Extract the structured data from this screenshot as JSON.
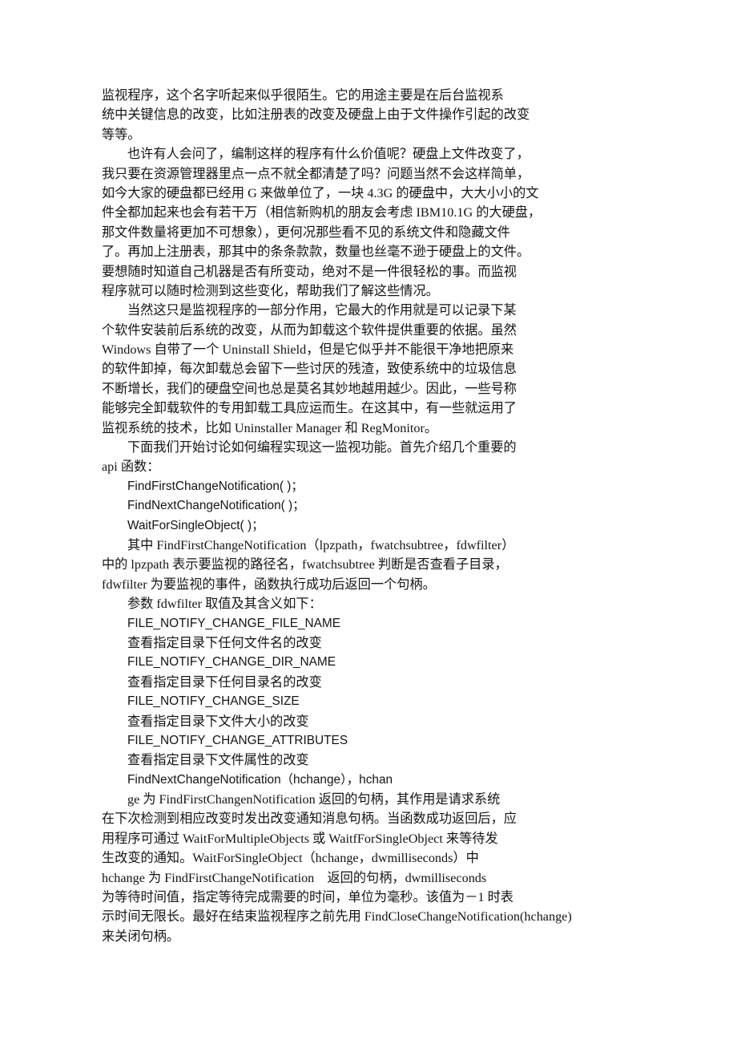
{
  "document": {
    "page_background": "#ffffff",
    "text_color": "#141414",
    "lines": [
      {
        "id": "l1",
        "indent": 0,
        "script": "cjk",
        "text": "监视程序，这个名字听起来似乎很陌生。它的用途主要是在后台监视系"
      },
      {
        "id": "l2",
        "indent": 0,
        "script": "cjk",
        "text": "统中关键信息的改变，比如注册表的改变及硬盘上由于文件操作引起的改变"
      },
      {
        "id": "l3",
        "indent": 0,
        "script": "cjk",
        "text": "等等。"
      },
      {
        "id": "l4",
        "indent": 1,
        "script": "cjk",
        "text": "也许有人会问了，编制这样的程序有什么价值呢？硬盘上文件改变了，"
      },
      {
        "id": "l5",
        "indent": 0,
        "script": "cjk",
        "text": "我只要在资源管理器里点一点不就全都清楚了吗？问题当然不会这样简单，"
      },
      {
        "id": "l6",
        "indent": 0,
        "script": "cjk",
        "text": "如今大家的硬盘都已经用 G 来做单位了，一块 4.3G 的硬盘中，大大小小的文"
      },
      {
        "id": "l7",
        "indent": 0,
        "script": "cjk",
        "text": "件全都加起来也会有若干万（相信新购机的朋友会考虑 IBM10.1G 的大硬盘，"
      },
      {
        "id": "l8",
        "indent": 0,
        "script": "cjk",
        "text": "那文件数量将更加不可想象），更何况那些看不见的系统文件和隐藏文件"
      },
      {
        "id": "l9",
        "indent": 0,
        "script": "cjk",
        "text": "了。再加上注册表，那其中的条条款款，数量也丝毫不逊于硬盘上的文件。"
      },
      {
        "id": "l10",
        "indent": 0,
        "script": "cjk",
        "text": "要想随时知道自己机器是否有所变动，绝对不是一件很轻松的事。而监视"
      },
      {
        "id": "l11",
        "indent": 0,
        "script": "cjk",
        "text": "程序就可以随时检测到这些变化，帮助我们了解这些情况。"
      },
      {
        "id": "l12",
        "indent": 1,
        "script": "cjk",
        "text": "当然这只是监视程序的一部分作用，它最大的作用就是可以记录下某"
      },
      {
        "id": "l13",
        "indent": 0,
        "script": "cjk",
        "text": "个软件安装前后系统的改变，从而为卸载这个软件提供重要的依据。虽然"
      },
      {
        "id": "l14",
        "indent": 0,
        "script": "cjk",
        "text": "Windows 自带了一个 Uninstall Shield，但是它似乎并不能很干净地把原来"
      },
      {
        "id": "l15",
        "indent": 0,
        "script": "cjk",
        "text": "的软件卸掉，每次卸载总会留下一些讨厌的残渣，致使系统中的垃圾信息"
      },
      {
        "id": "l16",
        "indent": 0,
        "script": "cjk",
        "text": "不断增长，我们的硬盘空间也总是莫名其妙地越用越少。因此，一些号称"
      },
      {
        "id": "l17",
        "indent": 0,
        "script": "cjk",
        "text": "能够完全卸载软件的专用卸载工具应运而生。在这其中，有一些就运用了"
      },
      {
        "id": "l18",
        "indent": 0,
        "script": "cjk",
        "text": "监视系统的技术，比如 Uninstaller Manager 和 RegMonitor。"
      },
      {
        "id": "l19",
        "indent": 1,
        "script": "cjk",
        "text": "下面我们开始讨论如何编程实现这一监视功能。首先介绍几个重要的"
      },
      {
        "id": "l20",
        "indent": 0,
        "script": "cjk",
        "text": "api 函数："
      },
      {
        "id": "l21",
        "indent": 1,
        "script": "sans",
        "text": "FindFirstChangeNotification( )；"
      },
      {
        "id": "l22",
        "indent": 1,
        "script": "sans",
        "text": "FindNextChangeNotification( )；"
      },
      {
        "id": "l23",
        "indent": 1,
        "script": "sans",
        "text": "WaitForSingleObject( )；"
      },
      {
        "id": "l24",
        "indent": 1,
        "script": "cjk",
        "text": "其中 FindFirstChangeNotification（lpzpath，fwatchsubtree，fdwfilter）"
      },
      {
        "id": "l25",
        "indent": 0,
        "script": "cjk",
        "text": "中的 lpzpath 表示要监视的路径名，fwatchsubtree 判断是否查看子目录，"
      },
      {
        "id": "l26",
        "indent": 0,
        "script": "cjk",
        "text": "fdwfilter 为要监视的事件，函数执行成功后返回一个句柄。"
      },
      {
        "id": "l27",
        "indent": 1,
        "script": "cjk",
        "text": "参数 fdwfilter 取值及其含义如下："
      },
      {
        "id": "l28",
        "indent": 1,
        "script": "sans",
        "text": "FILE_NOTIFY_CHANGE_FILE_NAME"
      },
      {
        "id": "l29",
        "indent": 1,
        "script": "cjk",
        "text": "查看指定目录下任何文件名的改变"
      },
      {
        "id": "l30",
        "indent": 1,
        "script": "sans",
        "text": "FILE_NOTIFY_CHANGE_DIR_NAME"
      },
      {
        "id": "l31",
        "indent": 1,
        "script": "cjk",
        "text": "查看指定目录下任何目录名的改变"
      },
      {
        "id": "l32",
        "indent": 1,
        "script": "sans",
        "text": "FILE_NOTIFY_CHANGE_SIZE"
      },
      {
        "id": "l33",
        "indent": 1,
        "script": "cjk",
        "text": "查看指定目录下文件大小的改变"
      },
      {
        "id": "l34",
        "indent": 1,
        "script": "sans",
        "text": "FILE_NOTIFY_CHANGE_ATTRIBUTES"
      },
      {
        "id": "l35",
        "indent": 1,
        "script": "cjk",
        "text": "查看指定目录下文件属性的改变"
      },
      {
        "id": "l36",
        "indent": 1,
        "script": "sans",
        "text": "FindNextChangeNotification（hchange），hchan"
      },
      {
        "id": "l37",
        "indent": 1,
        "script": "cjk",
        "text": "ge 为 FindFirstChangenNotification 返回的句柄，其作用是请求系统"
      },
      {
        "id": "l38",
        "indent": 0,
        "script": "cjk",
        "text": "在下次检测到相应改变时发出改变通知消息句柄。当函数成功返回后，应"
      },
      {
        "id": "l39",
        "indent": 0,
        "script": "cjk",
        "text": "用程序可通过 WaitForMultipleObjects 或 WaitfForSingleObject 来等待发"
      },
      {
        "id": "l40",
        "indent": 0,
        "script": "cjk",
        "text": "生改变的通知。WaitForSingleObject（hchange，dwmilliseconds）中"
      },
      {
        "id": "l41",
        "indent": 0,
        "script": "cjk",
        "text": "hchange 为 FindFirstChangeNotification    返回的句柄，dwmilliseconds"
      },
      {
        "id": "l42",
        "indent": 0,
        "script": "cjk",
        "text": "为等待时间值，指定等待完成需要的时间，单位为毫秒。该值为－1 时表"
      },
      {
        "id": "l43",
        "indent": 0,
        "script": "cjk",
        "text": "示时间无限长。最好在结束监视程序之前先用 FindCloseChangeNotification(hchange)"
      },
      {
        "id": "l44",
        "indent": 0,
        "script": "cjk",
        "text": "来关闭句柄。"
      }
    ]
  }
}
